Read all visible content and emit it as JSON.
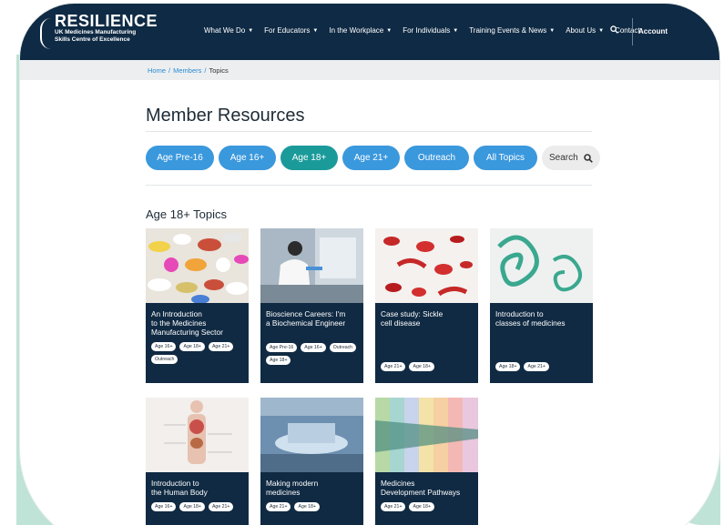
{
  "header": {
    "brand": "RESILIENCE",
    "brand_sub_1": "UK Medicines Manufacturing",
    "brand_sub_2": "Skills Centre of Excellence",
    "nav": [
      "What We Do",
      "For Educators",
      "In the Workplace",
      "For Individuals",
      "Training Events & News",
      "About Us",
      "Contact"
    ],
    "account": "Account"
  },
  "breadcrumb": {
    "home": "Home",
    "members": "Members",
    "current": "Topics",
    "sep": "/"
  },
  "page_title": "Member Resources",
  "filters": [
    {
      "label": "Age Pre-16",
      "active": false
    },
    {
      "label": "Age 16+",
      "active": false
    },
    {
      "label": "Age 18+",
      "active": true
    },
    {
      "label": "Age 21+",
      "active": false
    },
    {
      "label": "Outreach",
      "active": false
    },
    {
      "label": "All Topics",
      "active": false
    }
  ],
  "search_label": "Search",
  "section_title": "Age 18+ Topics",
  "topics": [
    {
      "title_lines": [
        "An Introduction",
        "to the Medicines",
        "Manufacturing Sector"
      ],
      "tags": [
        "Age 16+",
        "Age 18+",
        "Age 21+",
        "Outreach"
      ]
    },
    {
      "title_lines": [
        "Bioscience Careers: I'm",
        "a Biochemical Engineer"
      ],
      "tags": [
        "Age Pre-16",
        "Age 16+",
        "Outreach",
        "Age 18+"
      ]
    },
    {
      "title_lines": [
        "Case study: Sickle",
        "cell disease"
      ],
      "tags": [
        "Age 21+",
        "Age 18+"
      ]
    },
    {
      "title_lines": [
        "Introduction to",
        "classes of medicines"
      ],
      "tags": [
        "Age 18+",
        "Age 21+"
      ]
    },
    {
      "title_lines": [
        "Introduction to",
        "the Human Body"
      ],
      "tags": [
        "Age 16+",
        "Age 18+",
        "Age 21+"
      ]
    },
    {
      "title_lines": [
        "Making modern",
        "medicines"
      ],
      "tags": [
        "Age 21+",
        "Age 18+"
      ]
    },
    {
      "title_lines": [
        "Medicines",
        "Development Pathways"
      ],
      "tags": [
        "Age 21+",
        "Age 18+"
      ]
    }
  ],
  "colors": {
    "navy": "#0f2a44",
    "pill_blue": "#3a98dd",
    "pill_active": "#1b9a9a",
    "mint": "#bfe3d6"
  },
  "icons": {
    "search": "search-icon",
    "caret": "chevron-down-icon"
  }
}
